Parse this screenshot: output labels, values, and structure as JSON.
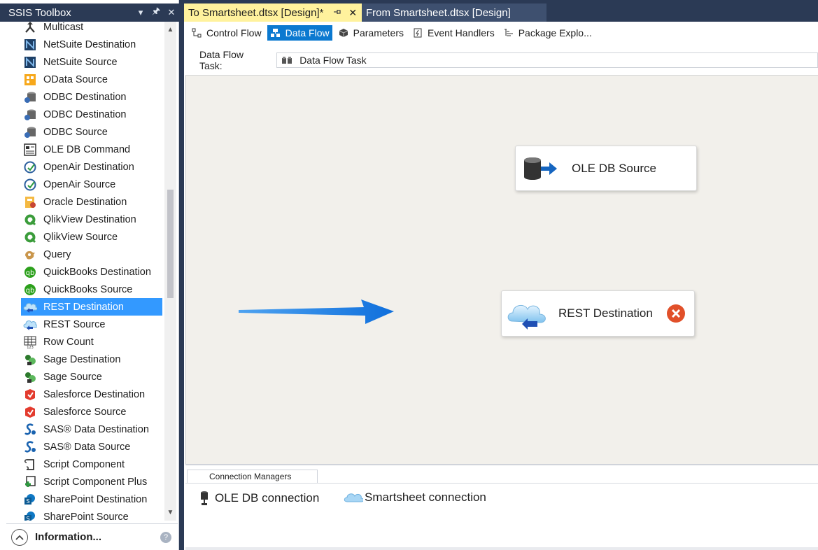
{
  "toolbox": {
    "title": "SSIS Toolbox",
    "header_buttons": [
      "▾",
      "🖈",
      "✕"
    ],
    "items": [
      {
        "label": "Multicast",
        "icon": "multicast-icon"
      },
      {
        "label": "NetSuite Destination",
        "icon": "netsuite-icon"
      },
      {
        "label": "NetSuite Source",
        "icon": "netsuite-icon"
      },
      {
        "label": "OData Source",
        "icon": "odata-icon"
      },
      {
        "label": "ODBC Destination",
        "icon": "odbc-icon"
      },
      {
        "label": "ODBC Destination",
        "icon": "odbc-icon"
      },
      {
        "label": "ODBC Source",
        "icon": "odbc-icon"
      },
      {
        "label": "OLE DB Command",
        "icon": "oledb-command-icon"
      },
      {
        "label": "OpenAir Destination",
        "icon": "openair-icon"
      },
      {
        "label": "OpenAir Source",
        "icon": "openair-icon"
      },
      {
        "label": "Oracle Destination",
        "icon": "oracle-icon"
      },
      {
        "label": "QlikView Destination",
        "icon": "qlikview-icon"
      },
      {
        "label": "QlikView Source",
        "icon": "qlikview-icon"
      },
      {
        "label": "Query",
        "icon": "query-icon"
      },
      {
        "label": "QuickBooks Destination",
        "icon": "quickbooks-icon"
      },
      {
        "label": "QuickBooks Source",
        "icon": "quickbooks-icon"
      },
      {
        "label": "REST Destination",
        "icon": "rest-icon",
        "selected": true
      },
      {
        "label": "REST Source",
        "icon": "rest-icon"
      },
      {
        "label": "Row Count",
        "icon": "row-count-icon"
      },
      {
        "label": "Sage Destination",
        "icon": "sage-icon"
      },
      {
        "label": "Sage Source",
        "icon": "sage-icon"
      },
      {
        "label": "Salesforce Destination",
        "icon": "salesforce-icon"
      },
      {
        "label": "Salesforce Source",
        "icon": "salesforce-icon"
      },
      {
        "label": "SAS® Data Destination",
        "icon": "sas-icon"
      },
      {
        "label": "SAS® Data Source",
        "icon": "sas-icon"
      },
      {
        "label": "Script Component",
        "icon": "script-icon"
      },
      {
        "label": "Script Component Plus",
        "icon": "script-plus-icon"
      },
      {
        "label": "SharePoint Destination",
        "icon": "sharepoint-icon"
      },
      {
        "label": "SharePoint Source",
        "icon": "sharepoint-icon"
      }
    ],
    "info_label": "Information...",
    "help": "?"
  },
  "doc_tabs": [
    {
      "label": "To Smartsheet.dtsx [Design]*",
      "active": true,
      "pin": "⊣",
      "close": "✕"
    },
    {
      "label": "From Smartsheet.dtsx [Design]",
      "active": false
    }
  ],
  "designer_tabs": [
    {
      "label": "Control Flow",
      "icon": "control-flow-icon"
    },
    {
      "label": "Data Flow",
      "icon": "data-flow-icon",
      "active": true
    },
    {
      "label": "Parameters",
      "icon": "parameters-icon"
    },
    {
      "label": "Event Handlers",
      "icon": "event-handlers-icon"
    },
    {
      "label": "Package Explo...",
      "icon": "package-explorer-icon"
    }
  ],
  "task": {
    "label": "Data Flow Task:",
    "value": "Data Flow Task"
  },
  "canvas": {
    "components": [
      {
        "label": "OLE DB Source",
        "icon": "oledb-source-icon"
      },
      {
        "label": "REST Destination",
        "icon": "rest-destination-icon",
        "error": true
      }
    ]
  },
  "connection_managers": {
    "tab_label": "Connection Managers",
    "items": [
      {
        "label": "OLE DB connection",
        "icon": "oledb-connection-icon"
      },
      {
        "label": "Smartsheet connection",
        "icon": "smartsheet-connection-icon"
      }
    ]
  },
  "colors": {
    "selection": "#3399ff",
    "active_doc_tab": "#fff29d",
    "chrome": "#2b3a55",
    "canvas": "#f2f0eb",
    "arrow": "#1a7fe6",
    "error": "#e1502a"
  }
}
